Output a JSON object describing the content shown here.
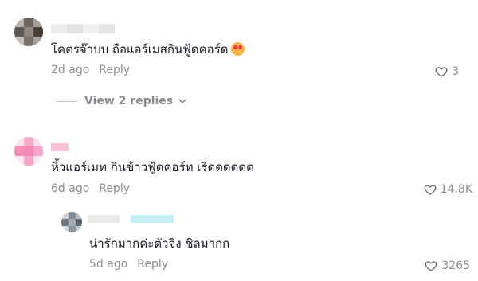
{
  "comments": [
    {
      "text": "โคตรจ๊าบบ ถือแอร์เมสกินฟู้ดคอร์ด",
      "emoji": "smiling-face-with-hearts",
      "time": "2d ago",
      "reply_label": "Reply",
      "likes": "3",
      "view_replies": "View 2 replies"
    },
    {
      "text": "หิ้วแอร์เมท กินข้าวฟู้ดคอร์ท เริ่ดดดดดด",
      "time": "6d ago",
      "reply_label": "Reply",
      "likes": "14.8K"
    }
  ],
  "replies": [
    {
      "text": "น่ารักมากค่ะตัวจิง ชิลมากก",
      "time": "5d ago",
      "reply_label": "Reply",
      "likes": "3265"
    }
  ],
  "icons": {
    "like": "heart-outline-icon",
    "expand": "chevron-down-icon"
  }
}
